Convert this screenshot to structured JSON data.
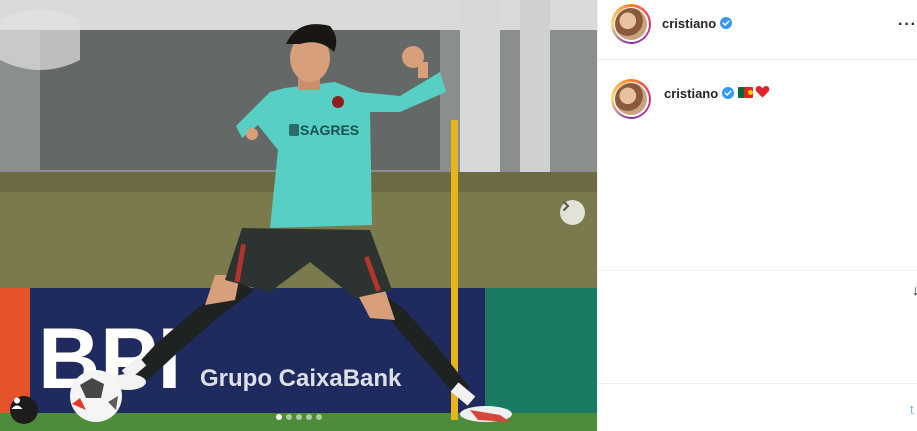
{
  "photo": {
    "sponsor_shirt": "SAGRES",
    "banner_left": "BPI",
    "banner_right": "Grupo CaixaBank",
    "carousel_dots": 5,
    "active_dot": 1
  },
  "post_header": {
    "username": "cristiano",
    "verified": true,
    "more_icon": "more-horizontal-icon"
  },
  "caption": {
    "username": "cristiano",
    "verified": true,
    "emojis": [
      "portugal-flag-icon",
      "red-heart-icon"
    ]
  },
  "colors": {
    "verified_blue": "#3897f0",
    "text": "#262626",
    "jersey": "#58cfc4",
    "shorts": "#2c3330",
    "banner": "#1f2a5e",
    "pitch": "#4d8c3a"
  },
  "side_glyph": "↓",
  "bottom_right_letter": "t"
}
